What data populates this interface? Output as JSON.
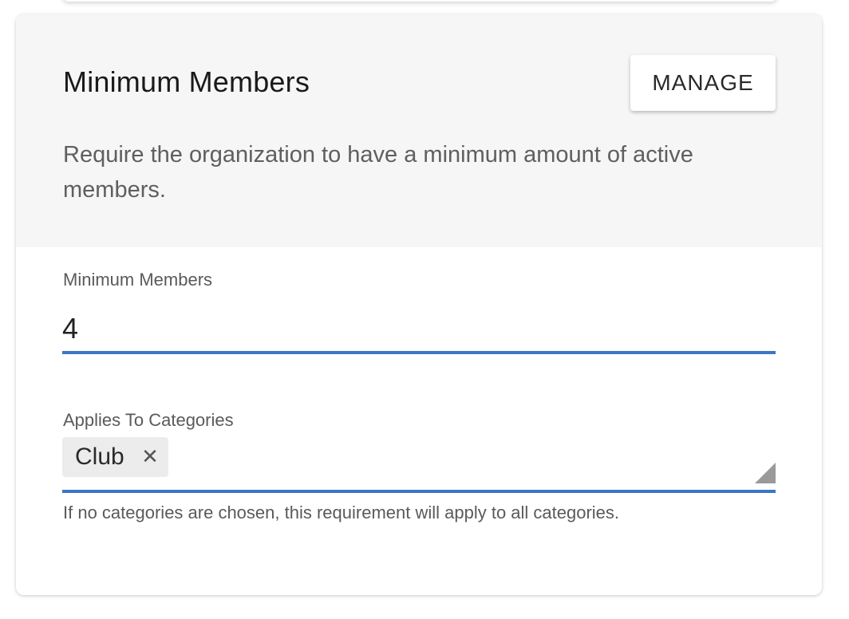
{
  "card": {
    "title": "Minimum Members",
    "manage_label": "MANAGE",
    "description": "Require the organization to have a minimum amount of active members."
  },
  "minimum_members_field": {
    "label": "Minimum Members",
    "value": "4"
  },
  "categories_field": {
    "label": "Applies To Categories",
    "chips": [
      {
        "label": "Club",
        "remove_icon": "close-icon"
      }
    ],
    "helper_text": "If no categories are chosen, this requirement will apply to all categories."
  },
  "colors": {
    "accent_underline": "#3a76c4",
    "header_background": "#f6f6f6",
    "chip_background": "#ececec"
  }
}
